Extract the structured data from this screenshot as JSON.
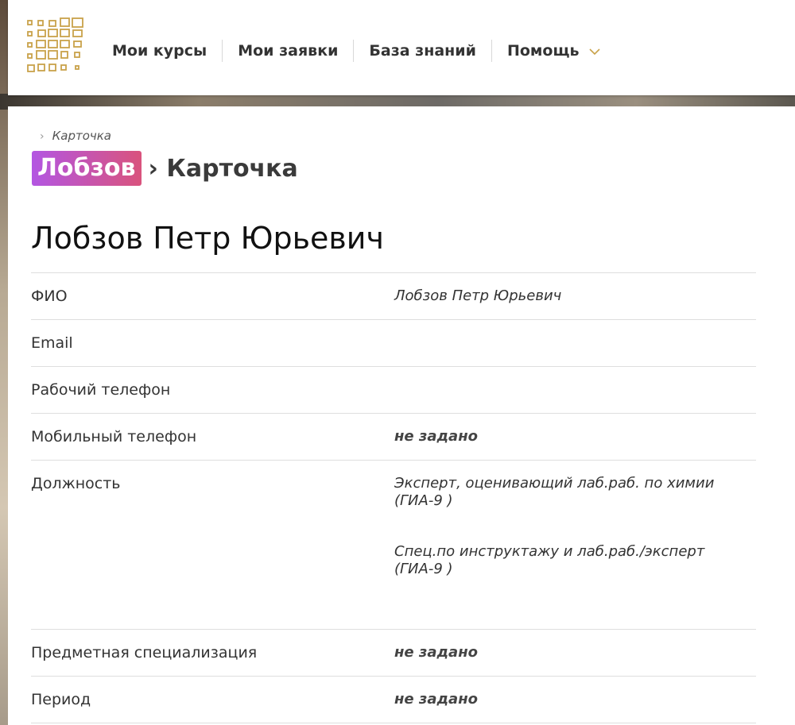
{
  "nav": {
    "items": [
      "Мои курсы",
      "Мои заявки",
      "База знаний",
      "Помощь"
    ]
  },
  "breadcrumb": {
    "current": "Карточка"
  },
  "title": {
    "badge": "Лобзов",
    "rest": "› Карточка"
  },
  "person": {
    "full_name": "Лобзов Петр Юрьевич"
  },
  "fields": {
    "fio": {
      "label": "ФИО",
      "value": "Лобзов Петр Юрьевич"
    },
    "email": {
      "label": "Email",
      "value": ""
    },
    "work_phone": {
      "label": "Рабочий телефон",
      "value": ""
    },
    "mobile_phone": {
      "label": "Мобильный телефон",
      "value": "не задано"
    },
    "position": {
      "label": "Должность",
      "values": [
        "Эксперт, оценивающий лаб.раб. по химии (ГИА-9 )",
        "Спец.по инструктажу и лаб.раб./эксперт (ГИА-9 )"
      ]
    },
    "specialization": {
      "label": "Предметная специализация",
      "value": "не задано"
    },
    "period": {
      "label": "Период",
      "value": "не задано"
    }
  },
  "colors": {
    "logo": "#c9a24a",
    "badge_start": "#b356e2",
    "badge_end": "#d9537d"
  }
}
